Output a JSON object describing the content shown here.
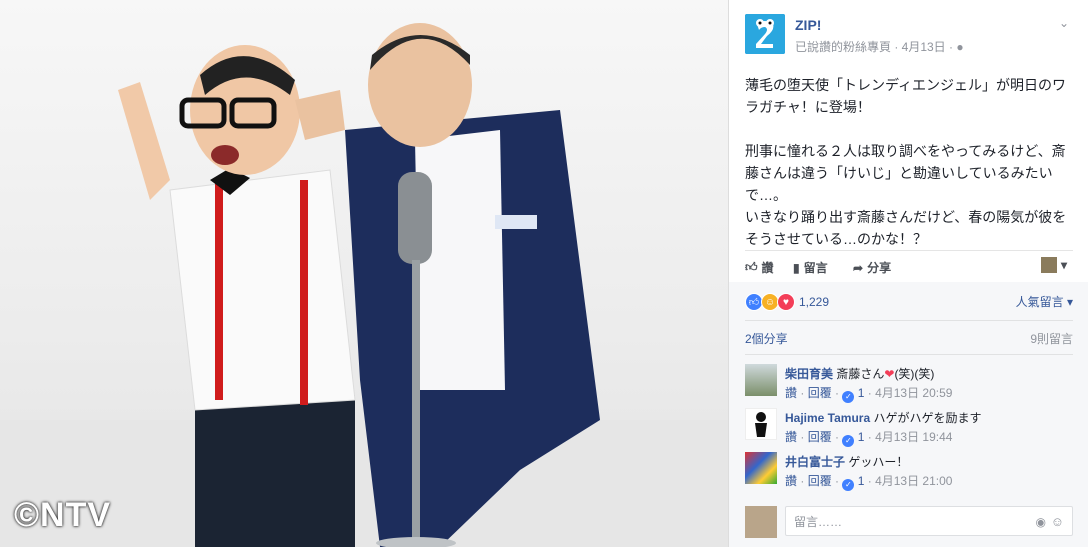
{
  "photo": {
    "watermark": "©NTV"
  },
  "post": {
    "page_name": "ZIP!",
    "meta": "已說讚的粉絲專頁 · 4月13日 ·",
    "text": "薄毛の堕天使「トレンディエンジェル」が明日のワラガチャ！に登場！\n\n刑事に憧れる２人は取り調べをやってみるけど、斎藤さんは違う「けいじ」と勘違いしているみたいで…。\nいきなり踊り出す斎藤さんだけど、春の陽気が彼をそうさせている…のかな！？"
  },
  "actions": {
    "like": "讚",
    "comment": "留言",
    "share": "分享"
  },
  "reactions": {
    "count": "1,229",
    "sort_label": "人氣留言"
  },
  "stats": {
    "shares": "2個分享",
    "comments": "9則留言"
  },
  "comments": [
    {
      "name": "柴田育美",
      "text": "斎藤さん",
      "suffix": "(笑)(笑)",
      "like": "讚",
      "reply": "回覆",
      "likes": "1",
      "time": "4月13日 20:59"
    },
    {
      "name": "Hajime Tamura",
      "text": "ハゲがハゲを励ます",
      "like": "讚",
      "reply": "回覆",
      "likes": "1",
      "time": "4月13日 19:44"
    },
    {
      "name": "井白富士子",
      "text": "ゲッハー！",
      "like": "讚",
      "reply": "回覆",
      "likes": "1",
      "time": "4月13日 21:00"
    }
  ],
  "composer": {
    "placeholder": "留言……"
  },
  "colors": {
    "link": "#365899",
    "like_blue": "#4080ff",
    "love": "#f33e58",
    "haha": "#f7b125"
  }
}
